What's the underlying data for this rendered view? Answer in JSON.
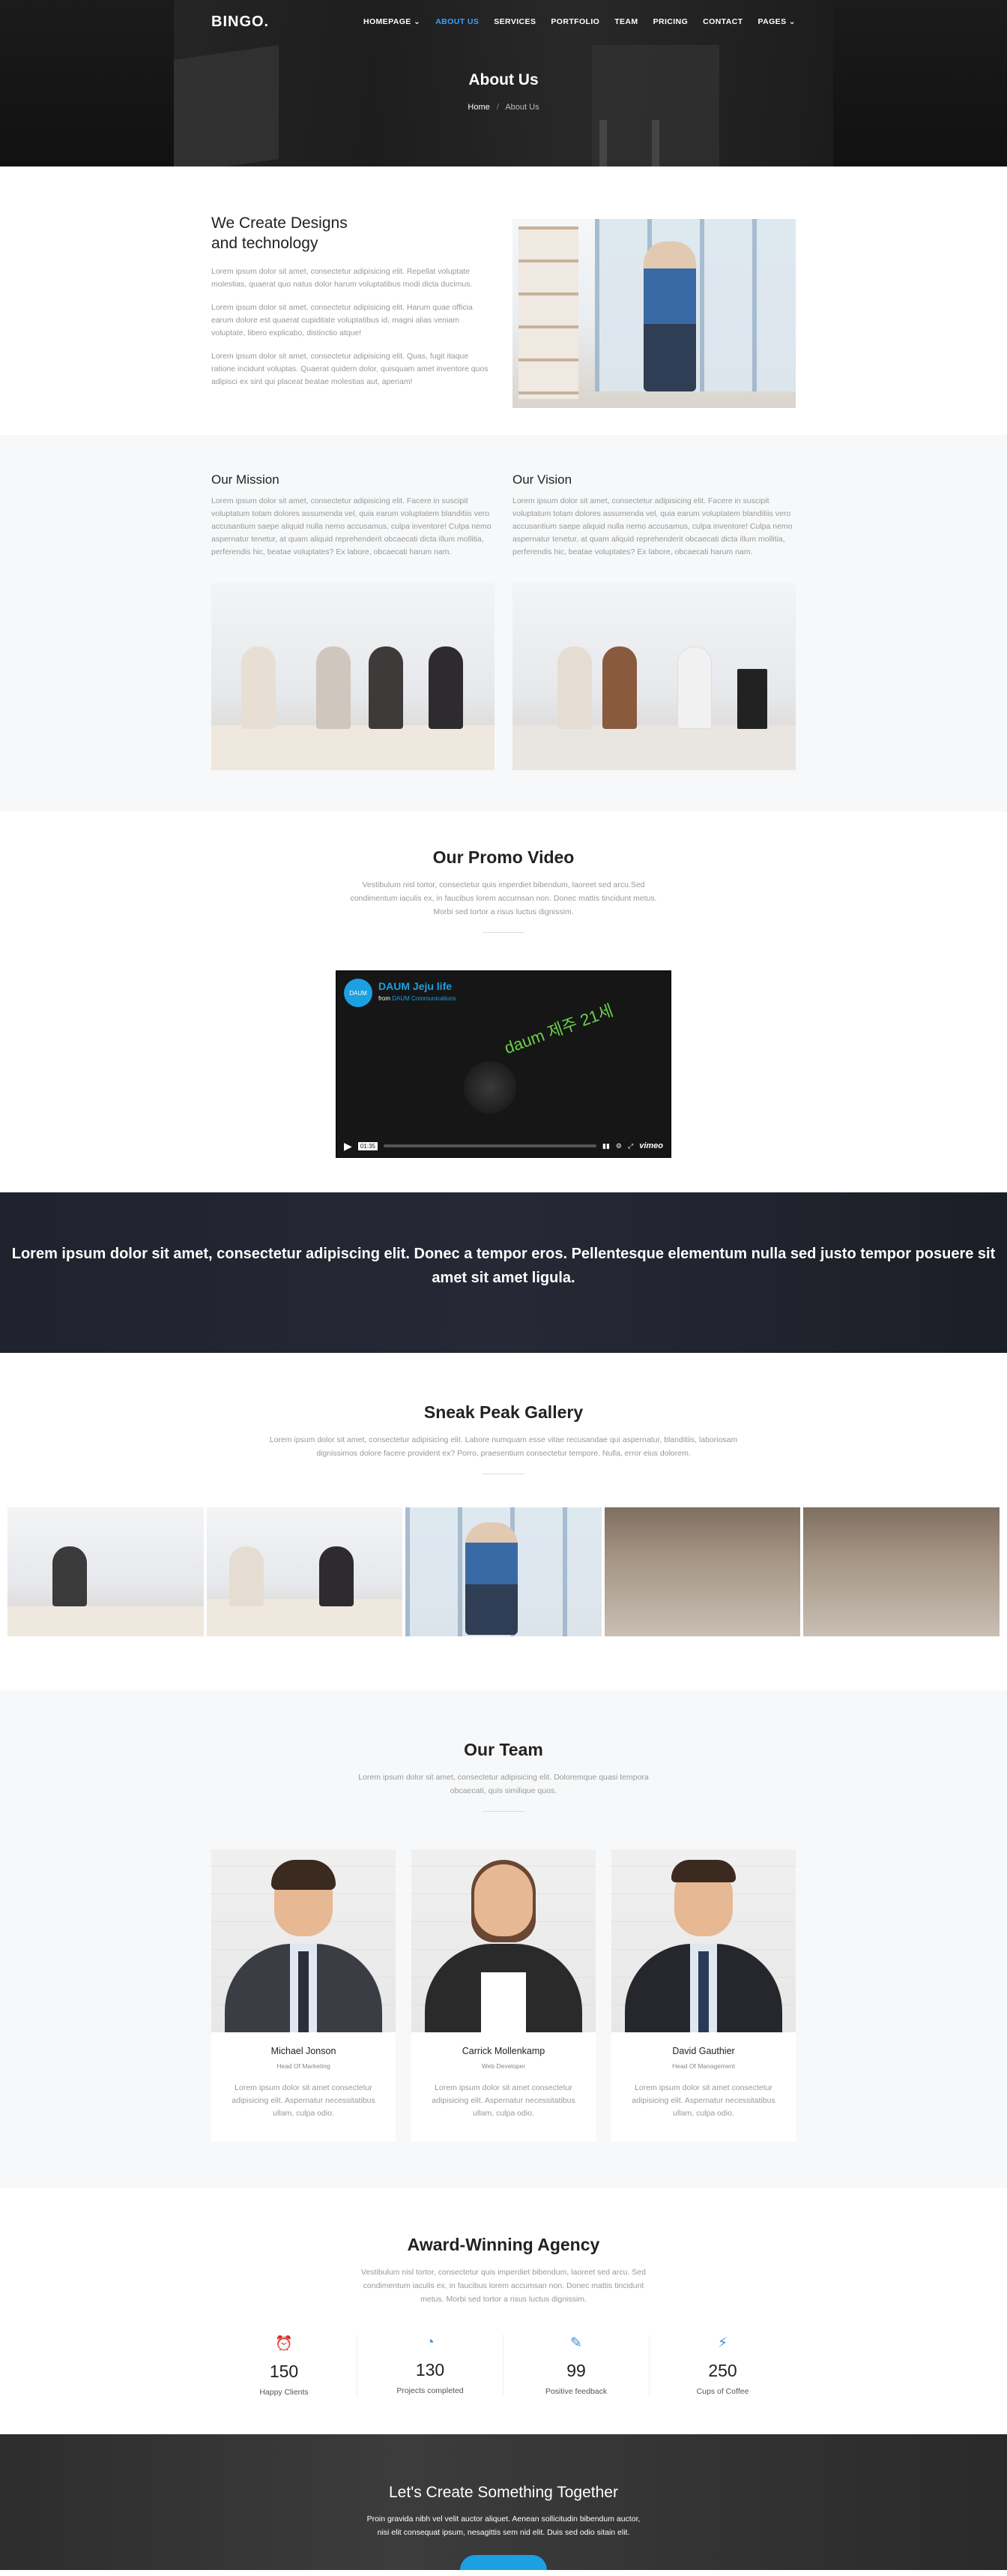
{
  "nav": {
    "brand": "BINGO.",
    "items": [
      {
        "label": "HOMEPAGE ⌄"
      },
      {
        "label": "ABOUT US"
      },
      {
        "label": "SERVICES"
      },
      {
        "label": "PORTFOLIO"
      },
      {
        "label": "TEAM"
      },
      {
        "label": "PRICING"
      },
      {
        "label": "CONTACT"
      },
      {
        "label": "PAGES ⌄"
      }
    ]
  },
  "hero": {
    "title": "About Us",
    "crumb_home": "Home",
    "crumb_sep": "/",
    "crumb_current": "About Us"
  },
  "about": {
    "heading": "We Create Designs and technology",
    "paragraphs": [
      "Lorem ipsum dolor sit amet, consectetur adipisicing elit. Repellat voluptate molestias, quaerat quo natus dolor harum voluptatibus modi dicta ducimus.",
      "Lorem ipsum dolor sit amet, consectetur adipisicing elit. Harum quae officia earum dolore est quaerat cupiditate voluptatibus id, magni alias veniam voluptate, libero explicabo, distinctio atque!",
      "Lorem ipsum dolor sit amet, consectetur adipisicing elit. Quas, fugit itaque ratione incidunt voluptas. Quaerat quidem dolor, quisquam amet inventore quos adipisci ex sint qui placeat beatae molestias aut, aperiam!"
    ]
  },
  "mission": {
    "title": "Our Mission",
    "text": "Lorem ipsum dolor sit amet, consectetur adipisicing elit. Facere in suscipit voluptatum totam dolores assumenda vel, quia earum voluptatem blanditiis vero accusantium saepe aliquid nulla nemo accusamus, culpa inventore! Culpa nemo aspernatur tenetur, at quam aliquid reprehenderit obcaecati dicta illum mollitia, perferendis hic, beatae voluptates? Ex labore, obcaecati harum nam."
  },
  "vision": {
    "title": "Our Vision",
    "text": "Lorem ipsum dolor sit amet, consectetur adipisicing elit. Facere in suscipit voluptatum totam dolores assumenda vel, quia earum voluptatem blanditiis vero accusantium saepe aliquid nulla nemo accusamus, culpa inventore! Culpa nemo aspernatur tenetur, at quam aliquid reprehenderit obcaecati dicta illum mollitia, perferendis hic, beatae voluptates? Ex labore, obcaecati harum nam."
  },
  "promo": {
    "title": "Our Promo Video",
    "subtitle": "Vestibulum nisl tortor, consectetur quis imperdiet bibendum, laoreet sed arcu.Sed condimentum iaculis ex, in faucibus lorem accumsan non. Donec mattis tincidunt metus. Morbi sed tortor a risus luctus dignissim.",
    "video": {
      "badge": "DAUM",
      "title": "DAUM Jeju life",
      "from_prefix": "from",
      "from_author": "DAUM Communications",
      "logo_text": "daum 제주 21세",
      "time": "01:35",
      "brand": "vimeo"
    }
  },
  "quote": {
    "text": "Lorem ipsum dolor sit amet, consectetur adipiscing elit. Donec a tempor eros. Pellentesque elementum nulla sed justo tempor posuere sit amet sit amet ligula."
  },
  "gallery": {
    "title": "Sneak Peak Gallery",
    "subtitle": "Lorem ipsum dolor sit amet, consectetur adipisicing elit. Labore numquam esse vitae recusandae qui aspernatur, blanditiis, laboriosam dignissimos dolore facere provident ex? Porro, praesentium consectetur tempore. Nulla, error eius dolorem."
  },
  "team": {
    "title": "Our Team",
    "subtitle": "Lorem ipsum dolor sit amet, consectetur adipisicing elit. Doloremque quasi tempora obcaecati, quis similique quos.",
    "members": [
      {
        "name": "Michael Jonson",
        "role": "Head Of Marketing",
        "bio": "Lorem ipsum dolor sit amet consectetur adipisicing elit. Aspernatur necessitatibus ullam, culpa odio."
      },
      {
        "name": "Carrick Mollenkamp",
        "role": "Web Developer",
        "bio": "Lorem ipsum dolor sit amet consectetur adipisicing elit. Aspernatur necessitatibus ullam, culpa odio."
      },
      {
        "name": "David Gauthier",
        "role": "Head Of Management",
        "bio": "Lorem ipsum dolor sit amet consectetur adipisicing elit. Aspernatur necessitatibus ullam, culpa odio."
      }
    ]
  },
  "awards": {
    "title": "Award-Winning Agency",
    "subtitle": "Vestibulum nisl tortor, consectetur quis imperdiet bibendum, laoreet sed arcu. Sed condimentum iaculis ex, in faucibus lorem accumsan non. Donec mattis tincidunt metus. Morbi sed tortor a risus luctus dignissim.",
    "stats": [
      {
        "icon": "⏰",
        "value": "150",
        "label": "Happy Clients"
      },
      {
        "icon": "◔",
        "value": "130",
        "label": "Projects completed"
      },
      {
        "icon": "✎",
        "value": "99",
        "label": "Positive feedback"
      },
      {
        "icon": "⚡",
        "value": "250",
        "label": "Cups of Coffee"
      }
    ]
  },
  "cta": {
    "title": "Let's Create Something Together",
    "text1": "Proin gravida nibh vel velit auctor aliquet. Aenean sollicitudin bibendum auctor,",
    "text2": "nisi elit consequat ipsum, nesagittis sem nid elit. Duis sed odio sitain elit."
  },
  "colors": {
    "accent": "#3aa0ff",
    "button": "#1ba0e1",
    "dark_band": "#20222d"
  }
}
